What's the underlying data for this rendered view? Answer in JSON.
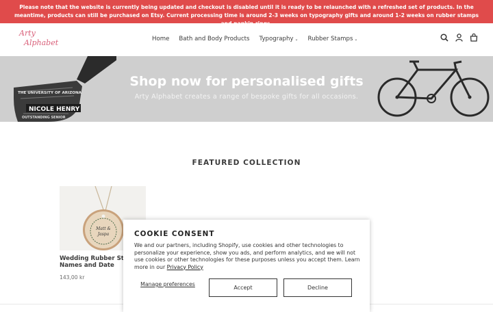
{
  "announcement": {
    "text": "Please note that the website is currently being updated and checkout is disabled until it is ready to be relaunched with a refreshed set of products. In the meantime, products can still be purchased on Etsy. Current processing time is around 2-3 weeks on typography gifts and around 1-2 weeks on rubber stamps and napkin rings."
  },
  "header": {
    "logo_line1": "Arty",
    "logo_line2": "Alphabet",
    "nav": [
      {
        "label": "Home"
      },
      {
        "label": "Bath and Body Products"
      },
      {
        "label": "Typography",
        "caret": "⌄"
      },
      {
        "label": "Rubber Stamps",
        "caret": "⌄"
      }
    ],
    "icons": [
      "search-icon",
      "account-icon",
      "cart-icon"
    ]
  },
  "banner": {
    "title": "Shop now for personalised gifts",
    "subtitle": "Arty Alphabet creates a range of bespoke gifts for all occasions.",
    "art_text": [
      "THE UNIVERSITY OF ARIZONA",
      "NICOLE HENRY",
      "OUTSTANDING SENIOR"
    ]
  },
  "featured": {
    "heading": "FEATURED COLLECTION",
    "products": [
      {
        "name": "Wedding Rubber Stamp Names and Date",
        "price": "143,00 kr",
        "tag_line1": "Matt &",
        "tag_line2": "Jaspa"
      }
    ]
  },
  "cookie": {
    "title": "COOKIE CONSENT",
    "text": "We and our partners, including Shopify, use cookies and other technologies to personalize your experience, show you ads, and perform analytics, and we will not use cookies or other technologies for these purposes unless you accept them. Learn more in our ",
    "policy_link": "Privacy Policy",
    "manage_label": "Manage preferences",
    "accept_label": "Accept",
    "decline_label": "Decline"
  }
}
